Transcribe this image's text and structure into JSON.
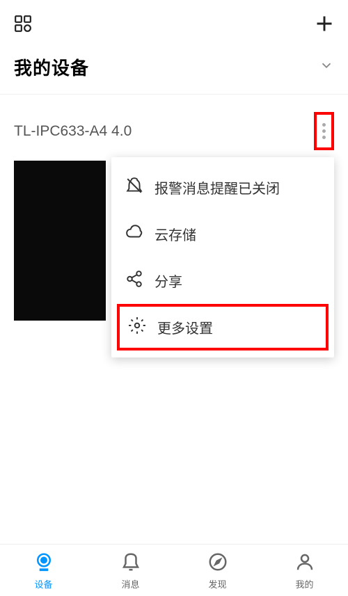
{
  "header": {
    "title": "我的设备"
  },
  "device": {
    "name": "TL-IPC633-A4 4.0"
  },
  "menu": {
    "items": [
      {
        "icon": "bell-off-icon",
        "label": "报警消息提醒已关闭"
      },
      {
        "icon": "cloud-icon",
        "label": "云存储"
      },
      {
        "icon": "share-icon",
        "label": "分享"
      },
      {
        "icon": "gear-icon",
        "label": "更多设置"
      }
    ]
  },
  "nav": {
    "items": [
      {
        "label": "设备",
        "active": true
      },
      {
        "label": "消息",
        "active": false
      },
      {
        "label": "发现",
        "active": false
      },
      {
        "label": "我的",
        "active": false
      }
    ]
  }
}
